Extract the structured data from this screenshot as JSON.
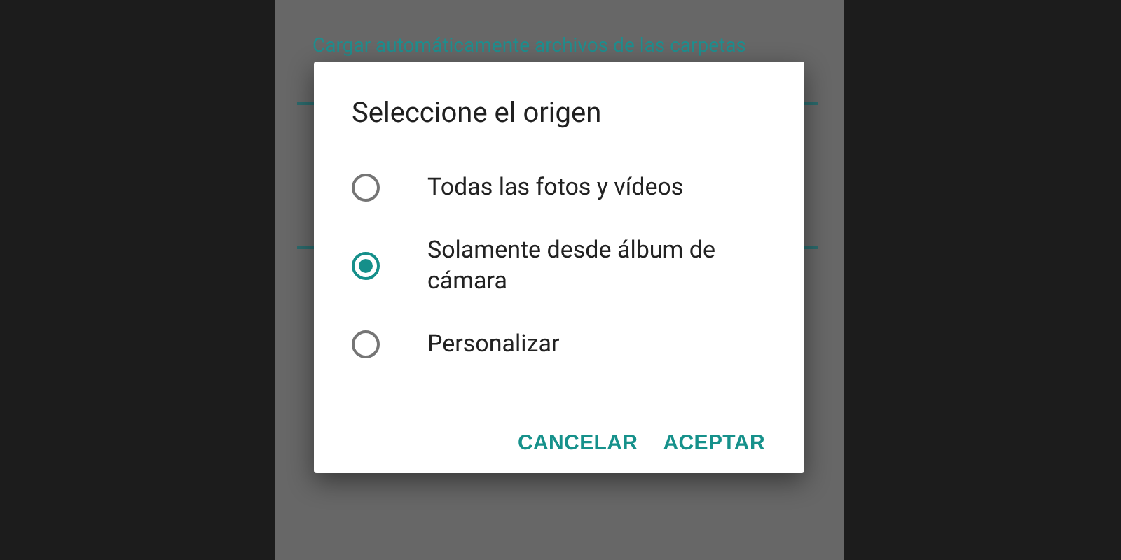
{
  "background": {
    "setting_link": "Cargar automáticamente archivos de las carpetas"
  },
  "dialog": {
    "title": "Seleccione el origen",
    "options": [
      {
        "label": "Todas las fotos y vídeos",
        "selected": false
      },
      {
        "label": "Solamente desde álbum de cámara",
        "selected": true
      },
      {
        "label": "Personalizar",
        "selected": false
      }
    ],
    "buttons": [
      "CANCELAR",
      "ACEPTAR"
    ]
  }
}
